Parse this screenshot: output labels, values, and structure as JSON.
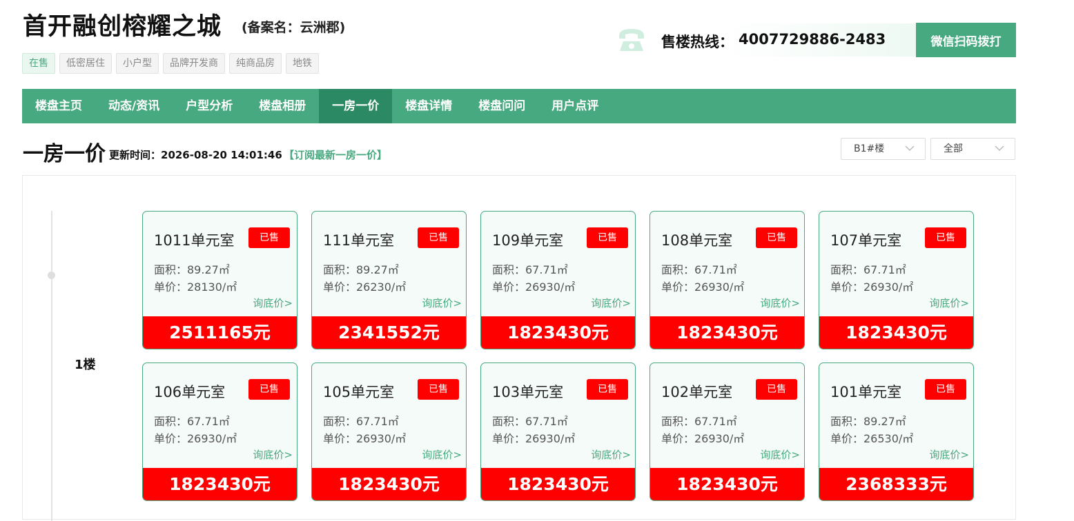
{
  "header": {
    "title": "首开融创榕耀之城",
    "record_name": "(备案名：云洲郡)",
    "tags": [
      "在售",
      "低密居住",
      "小户型",
      "品牌开发商",
      "纯商品房",
      "地铁"
    ],
    "hotline_label": "售楼热线：",
    "hotline_number": "4007729886-2483",
    "wechat_button": "微信扫码拨打",
    "accent_color": "#46a97f",
    "icons": [
      "phone-icon"
    ]
  },
  "nav": {
    "items": [
      "楼盘主页",
      "动态/资讯",
      "户型分析",
      "楼盘相册",
      "一房一价",
      "楼盘详情",
      "楼盘问问",
      "用户点评"
    ],
    "active": "一房一价"
  },
  "section": {
    "title": "一房一价",
    "update_label": "更新时间：2026-08-20 14:01:46",
    "subscribe": "【订阅最新一房一价】",
    "building_select": "B1#楼",
    "filter_select": "全部"
  },
  "floor": {
    "label": "1楼"
  },
  "units": [
    {
      "name": "1011单元室",
      "status": "已售",
      "area": "面积：89.27㎡",
      "unit_price": "单价：28130/㎡",
      "ask": "询底价>",
      "total": "2511165元"
    },
    {
      "name": "111单元室",
      "status": "已售",
      "area": "面积：89.27㎡",
      "unit_price": "单价：26230/㎡",
      "ask": "询底价>",
      "total": "2341552元"
    },
    {
      "name": "109单元室",
      "status": "已售",
      "area": "面积：67.71㎡",
      "unit_price": "单价：26930/㎡",
      "ask": "询底价>",
      "total": "1823430元"
    },
    {
      "name": "108单元室",
      "status": "已售",
      "area": "面积：67.71㎡",
      "unit_price": "单价：26930/㎡",
      "ask": "询底价>",
      "total": "1823430元"
    },
    {
      "name": "107单元室",
      "status": "已售",
      "area": "面积：67.71㎡",
      "unit_price": "单价：26930/㎡",
      "ask": "询底价>",
      "total": "1823430元"
    },
    {
      "name": "106单元室",
      "status": "已售",
      "area": "面积：67.71㎡",
      "unit_price": "单价：26930/㎡",
      "ask": "询底价>",
      "total": "1823430元"
    },
    {
      "name": "105单元室",
      "status": "已售",
      "area": "面积：67.71㎡",
      "unit_price": "单价：26930/㎡",
      "ask": "询底价>",
      "total": "1823430元"
    },
    {
      "name": "103单元室",
      "status": "已售",
      "area": "面积：67.71㎡",
      "unit_price": "单价：26930/㎡",
      "ask": "询底价>",
      "total": "1823430元"
    },
    {
      "name": "102单元室",
      "status": "已售",
      "area": "面积：67.71㎡",
      "unit_price": "单价：26930/㎡",
      "ask": "询底价>",
      "total": "1823430元"
    },
    {
      "name": "101单元室",
      "status": "已售",
      "area": "面积：89.27㎡",
      "unit_price": "单价：26530/㎡",
      "ask": "询底价>",
      "total": "2368333元"
    }
  ]
}
